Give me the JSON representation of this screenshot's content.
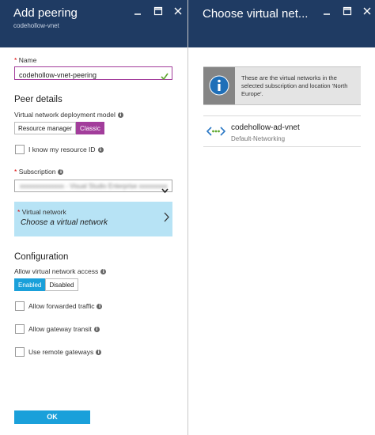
{
  "left_blade": {
    "title": "Add peering",
    "subtitle": "codehollow-vnet",
    "name_label": "Name",
    "name_value": "codehollow-vnet-peering",
    "peer_details_heading": "Peer details",
    "deployment_model_label": "Virtual network deployment model",
    "deployment_model_options": [
      "Resource manager",
      "Classic"
    ],
    "deployment_model_selected": "Classic",
    "know_resource_id_label": "I know my resource ID",
    "subscription_label": "Subscription",
    "subscription_value": "xxxxxxxxxxxxxx - Visual Studio Enterprise xxxxxxxxx",
    "vnet_label": "Virtual network",
    "vnet_placeholder": "Choose a virtual network",
    "configuration_heading": "Configuration",
    "allow_access_label": "Allow virtual network access",
    "access_options": [
      "Enabled",
      "Disabled"
    ],
    "access_selected": "Enabled",
    "allow_forwarded_label": "Allow forwarded traffic",
    "allow_gateway_label": "Allow gateway transit",
    "use_remote_label": "Use remote gateways",
    "ok_label": "OK"
  },
  "right_blade": {
    "title": "Choose virtual net...",
    "info_text": "These are the virtual networks in the selected subscription and location 'North Europe'.",
    "vnets": [
      {
        "name": "codehollow-ad-vnet",
        "resource_group": "Default-Networking"
      }
    ]
  },
  "colors": {
    "header_bg": "#1f3b63",
    "accent_purple": "#a23d9b",
    "accent_blue": "#1aa0da",
    "selection_bg": "#b7e3f5"
  }
}
